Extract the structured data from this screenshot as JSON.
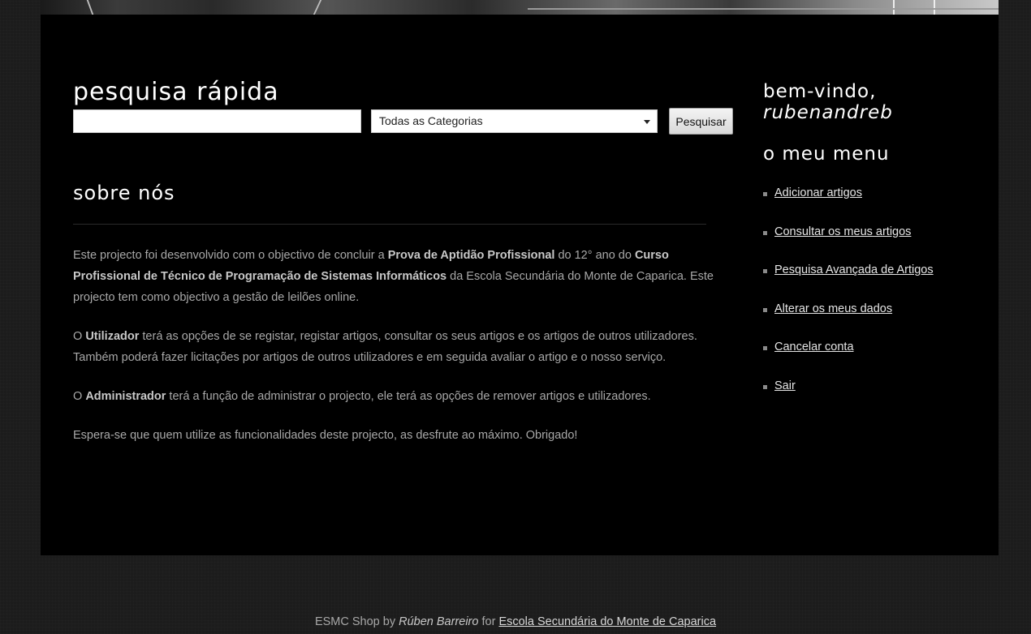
{
  "search": {
    "title": "pesquisa rápida",
    "input_value": "",
    "category_selected": "Todas as Categorias",
    "button_label": "Pesquisar"
  },
  "about": {
    "title": "sobre nós",
    "p1": {
      "a": "Este projecto foi desenvolvido com o objectivo de concluir a ",
      "b1": "Prova de Aptidão Profissional",
      "c": " do 12° ano do ",
      "b2": "Curso Profissional de Técnico de Programação de Sistemas Informáticos",
      "d": " da Escola Secundária do Monte de Caparica. Este projecto tem como objectivo a gestão de leilões online."
    },
    "p2": {
      "a": "O ",
      "b": "Utilizador",
      "c": " terá as opções de se registar, registar artigos, consultar os seus artigos e os artigos de outros utilizadores. Também poderá fazer licitações por artigos de outros utilizadores e em seguida avaliar o artigo e o nosso serviço."
    },
    "p3": {
      "a": "O ",
      "b": "Administrador",
      "c": " terá a função de administrar o projecto, ele terá as opções de remover artigos e utilizadores."
    },
    "p4": "Espera-se que quem utilize as funcionalidades deste projecto, as desfrute ao máximo. Obrigado!"
  },
  "sidebar": {
    "welcome": "bem-vindo,",
    "username": "rubenandreb",
    "menu_title": "o meu menu",
    "items": [
      {
        "label": "Adicionar artigos"
      },
      {
        "label": "Consultar os meus artigos"
      },
      {
        "label": "Pesquisa Avançada de Artigos"
      },
      {
        "label": "Alterar os meus dados"
      },
      {
        "label": "Cancelar conta"
      },
      {
        "label": "Sair"
      }
    ]
  },
  "footer": {
    "prefix": "ESMC Shop by ",
    "author": "Rúben Barreiro",
    "middle": " for ",
    "link": "Escola Secundária do Monte de Caparica"
  }
}
